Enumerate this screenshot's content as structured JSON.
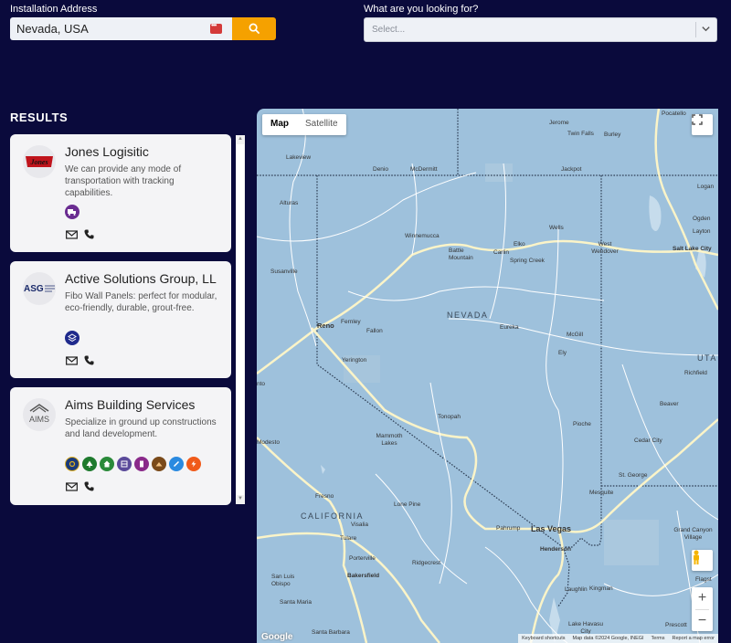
{
  "search": {
    "address_label": "Installation Address",
    "address_value": "Nevada, USA",
    "looking_label": "What are you looking for?",
    "select_placeholder": "Select..."
  },
  "results": {
    "title": "RESULTS",
    "items": [
      {
        "name": "Jones Logisitic",
        "description": "We can provide any mode of transportation with tracking capabilities.",
        "badges": [
          {
            "icon": "truck-icon",
            "color": "#6a2c91"
          }
        ]
      },
      {
        "name": "Active Solutions Group, LL",
        "description": "Fibo Wall Panels: perfect for modular, eco-friendly, durable, grout-free.",
        "badges": [
          {
            "icon": "layers-icon",
            "color": "#1f2a8c"
          }
        ]
      },
      {
        "name": "Aims Building Services",
        "description": "Specialize in ground up constructions and land development.",
        "badges": [
          {
            "icon": "tool-icon",
            "color": "#1a3a7a"
          },
          {
            "icon": "tree-icon",
            "color": "#1e7a2e"
          },
          {
            "icon": "house-icon",
            "color": "#2a8a3a"
          },
          {
            "icon": "panel-icon",
            "color": "#5a4a9a"
          },
          {
            "icon": "building-icon",
            "color": "#8a2a8a"
          },
          {
            "icon": "dirt-icon",
            "color": "#7a4a1a"
          },
          {
            "icon": "pen-icon",
            "color": "#2a8ae0"
          },
          {
            "icon": "bolt-icon",
            "color": "#f05a1a"
          }
        ]
      }
    ]
  },
  "map": {
    "tab_map": "Map",
    "tab_satellite": "Satellite",
    "state_nevada": "NEVADA",
    "state_california": "CALIFORNIA",
    "state_utah": "UTA",
    "google": "Google",
    "footer_shortcuts": "Keyboard shortcuts",
    "footer_data": "Map data ©2024 Google, INEGI",
    "footer_terms": "Terms",
    "footer_report": "Report a map error",
    "cities": {
      "pocatello": "Pocatello",
      "jerome": "Jerome",
      "twin_falls": "Twin Falls",
      "burley": "Burley",
      "lakeview": "Lakeview",
      "denio": "Denio",
      "mcdermitt": "McDermitt",
      "jackpot": "Jackpot",
      "logan": "Logan",
      "alturas": "Alturas",
      "winnemucca": "Winnemucca",
      "battle_mountain": "Battle Mountain",
      "carlin": "Carlin",
      "elko": "Elko",
      "wells": "Wells",
      "spring_creek": "Spring Creek",
      "west_wendover": "West Wendover",
      "ogden": "Ogden",
      "layton": "Layton",
      "salt_lake_city": "Salt Lake City",
      "susanville": "Susanville",
      "reno": "Reno",
      "fernley": "Fernley",
      "fallon": "Fallon",
      "eureka": "Eureka",
      "mcgill": "McGill",
      "ely": "Ely",
      "yerington": "Yerington",
      "richfield": "Richfield",
      "beaver": "Beaver",
      "tonopah": "Tonopah",
      "pioche": "Pioche",
      "cedar_city": "Cedar City",
      "modesto": "Modesto",
      "mammoth_lakes": "Mammoth Lakes",
      "st_george": "St. George",
      "mesquite": "Mesquite",
      "fresno": "Fresno",
      "lone_pine": "Lone Pine",
      "visalia": "Visalia",
      "pahrump": "Pahrump",
      "las_vegas": "Las Vegas",
      "henderson": "Henderson",
      "grand_canyon_village": "Grand Canyon Village",
      "tulare": "Tulare",
      "porterville": "Porterville",
      "bakersfield": "Bakersfield",
      "ridgecrest": "Ridgecrest",
      "san_luis_obispo": "San Luis Obispo",
      "santa_maria": "Santa Maria",
      "laughlin": "Laughlin",
      "kingman": "Kingman",
      "lake_havasu_city": "Lake Havasu City",
      "prescott": "Prescott",
      "santa_barbara": "Santa Barbara",
      "flagstaff": "Flagst",
      "nto": "nto"
    }
  }
}
